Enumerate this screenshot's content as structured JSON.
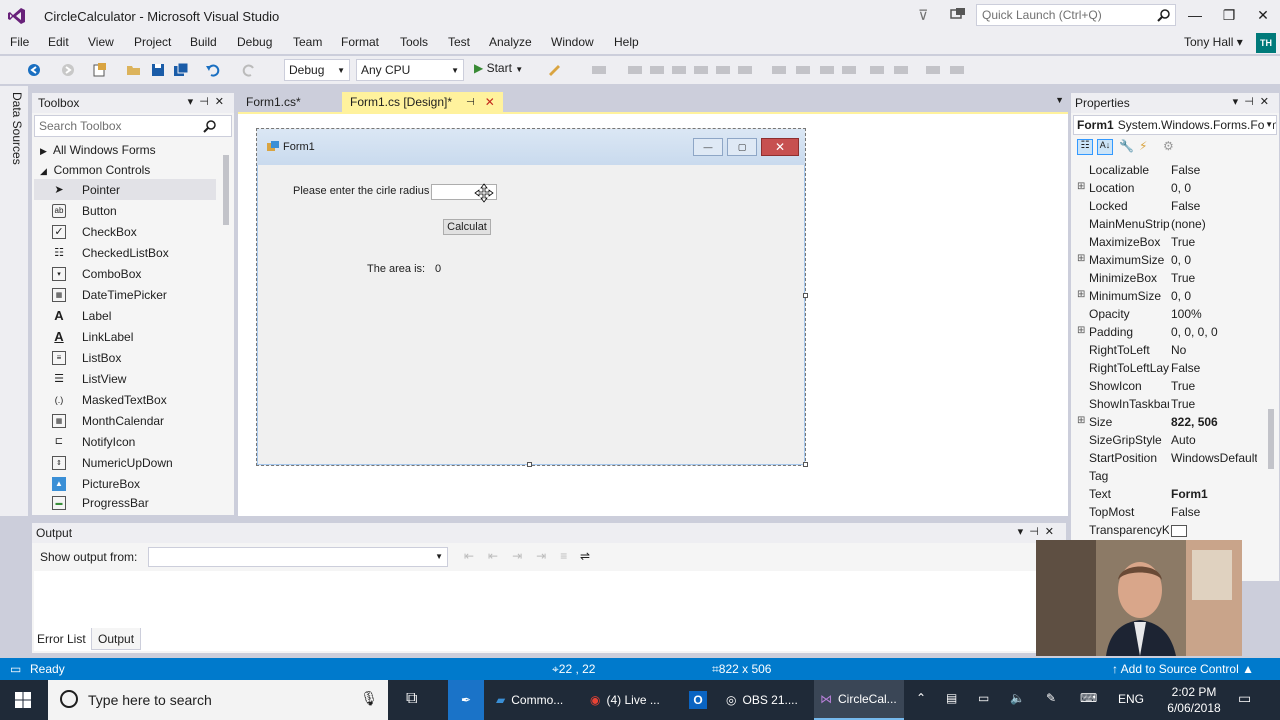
{
  "window": {
    "title": "CircleCalculator - Microsoft Visual Studio"
  },
  "quick_launch": {
    "placeholder": "Quick Launch (Ctrl+Q)"
  },
  "user": {
    "name": "Tony Hall",
    "initials": "TH"
  },
  "menu": [
    "File",
    "Edit",
    "View",
    "Project",
    "Build",
    "Debug",
    "Team",
    "Format",
    "Tools",
    "Test",
    "Analyze",
    "Window",
    "Help"
  ],
  "toolbar": {
    "config": "Debug",
    "platform": "Any CPU",
    "start_label": "Start"
  },
  "side_tab": {
    "label": "Data Sources"
  },
  "toolbox": {
    "title": "Toolbox",
    "search_placeholder": "Search Toolbox",
    "groups": [
      "All Windows Forms",
      "Common Controls"
    ],
    "items": [
      "Pointer",
      "Button",
      "CheckBox",
      "CheckedListBox",
      "ComboBox",
      "DateTimePicker",
      "Label",
      "LinkLabel",
      "ListBox",
      "ListView",
      "MaskedTextBox",
      "MonthCalendar",
      "NotifyIcon",
      "NumericUpDown",
      "PictureBox",
      "ProgressBar"
    ]
  },
  "doc_tabs": [
    {
      "label": "Form1.cs*"
    },
    {
      "label": "Form1.cs [Design]*"
    }
  ],
  "form": {
    "title": "Form1",
    "prompt_label": "Please enter the cirle radius",
    "button_label": "Calculat",
    "area_label": "The area is:",
    "area_value": "0"
  },
  "properties": {
    "title": "Properties",
    "object_name": "Form1",
    "object_type": "System.Windows.Forms.Form",
    "rows": [
      {
        "name": "Localizable",
        "value": "False",
        "expandable": false,
        "bold": false
      },
      {
        "name": "Location",
        "value": "0, 0",
        "expandable": true,
        "bold": false
      },
      {
        "name": "Locked",
        "value": "False",
        "expandable": false,
        "bold": false
      },
      {
        "name": "MainMenuStrip",
        "value": "(none)",
        "expandable": false,
        "bold": false
      },
      {
        "name": "MaximizeBox",
        "value": "True",
        "expandable": false,
        "bold": false
      },
      {
        "name": "MaximumSize",
        "value": "0, 0",
        "expandable": true,
        "bold": false
      },
      {
        "name": "MinimizeBox",
        "value": "True",
        "expandable": false,
        "bold": false
      },
      {
        "name": "MinimumSize",
        "value": "0, 0",
        "expandable": true,
        "bold": false
      },
      {
        "name": "Opacity",
        "value": "100%",
        "expandable": false,
        "bold": false
      },
      {
        "name": "Padding",
        "value": "0, 0, 0, 0",
        "expandable": true,
        "bold": false
      },
      {
        "name": "RightToLeft",
        "value": "No",
        "expandable": false,
        "bold": false
      },
      {
        "name": "RightToLeftLayout",
        "value": "False",
        "expandable": false,
        "bold": false
      },
      {
        "name": "ShowIcon",
        "value": "True",
        "expandable": false,
        "bold": false
      },
      {
        "name": "ShowInTaskbar",
        "value": "True",
        "expandable": false,
        "bold": false
      },
      {
        "name": "Size",
        "value": "822, 506",
        "expandable": true,
        "bold": true
      },
      {
        "name": "SizeGripStyle",
        "value": "Auto",
        "expandable": false,
        "bold": false
      },
      {
        "name": "StartPosition",
        "value": "WindowsDefaultLocation",
        "expandable": false,
        "bold": false
      },
      {
        "name": "Tag",
        "value": "",
        "expandable": false,
        "bold": false
      },
      {
        "name": "Text",
        "value": "Form1",
        "expandable": false,
        "bold": true
      },
      {
        "name": "TopMost",
        "value": "False",
        "expandable": false,
        "bold": false
      },
      {
        "name": "TransparencyKey",
        "value": "",
        "expandable": false,
        "bold": false
      }
    ]
  },
  "output": {
    "title": "Output",
    "show_from_label": "Show output from:"
  },
  "bottom_tabs": [
    "Error List",
    "Output"
  ],
  "status": {
    "ready": "Ready",
    "position": "22 , 22",
    "size": "822 x 506",
    "source_control": "Add to Source Control"
  },
  "taskbar": {
    "search_placeholder": "Type here to search",
    "apps": [
      "Commo...",
      "(4) Live ...",
      "OBS 21....",
      "CircleCal..."
    ],
    "language": "ENG",
    "time": "2:02 PM",
    "date": "6/06/2018"
  },
  "colors": {
    "accent": "#007acc",
    "active_tab": "#fff29d",
    "vs_purple": "#68217a"
  }
}
